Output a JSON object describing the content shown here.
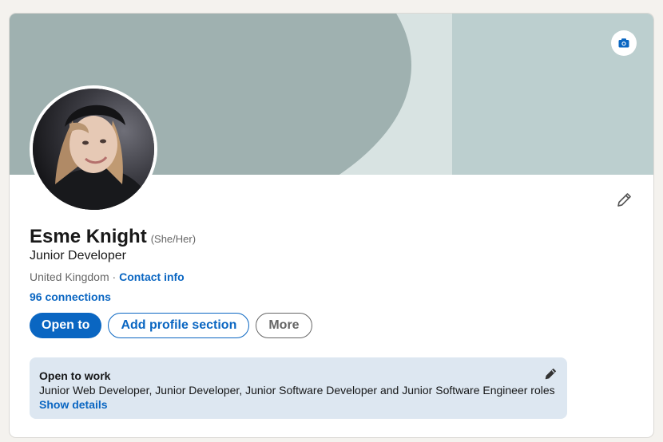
{
  "profile": {
    "name": "Esme Knight",
    "pronouns": "(She/Her)",
    "headline": "Junior Developer",
    "location": "United Kingdom",
    "separator": " · ",
    "contact_info": "Contact info",
    "connections": "96 connections"
  },
  "icons": {
    "banner_edit": "camera-icon",
    "profile_edit": "pencil-icon",
    "open_to_work_edit": "pencil-icon"
  },
  "actions": {
    "open_to": "Open to",
    "add_section": "Add profile section",
    "more": "More"
  },
  "open_to_work": {
    "title": "Open to work",
    "roles": "Junior Web Developer, Junior Developer, Junior Software Developer and Junior Software Engineer roles",
    "show_details": "Show details"
  },
  "colors": {
    "accent": "#0a66c2",
    "page_bg": "#f4f2ee",
    "banner_dark": "#9fb1b0",
    "banner_light": "#d8e3e2",
    "banner_right": "#bccfcf",
    "otw_bg": "#dde7f1"
  }
}
